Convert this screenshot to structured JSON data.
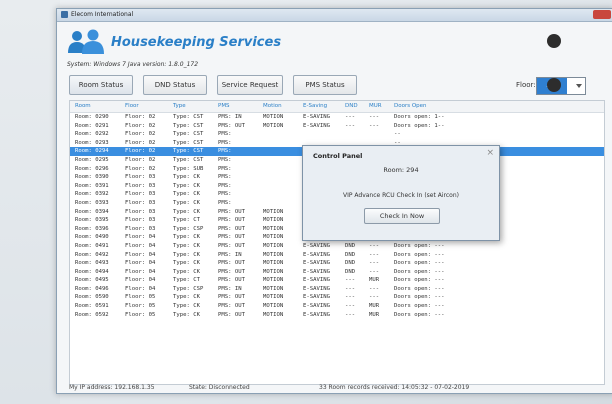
{
  "window": {
    "title": "Elecom International"
  },
  "app": {
    "title": "Housekeeping Services",
    "system_info": "System: Windows 7  Java version: 1.8.0_172"
  },
  "tabs": [
    {
      "label": "Room Status"
    },
    {
      "label": "DND Status"
    },
    {
      "label": "Service Request"
    },
    {
      "label": "PMS Status"
    }
  ],
  "floor": {
    "label": "Floor:",
    "value": "ALL"
  },
  "table": {
    "headers": [
      "Room",
      "Floor",
      "Type",
      "PMS",
      "Motion",
      "E-Saving",
      "DND",
      "MUR",
      "Doors Open"
    ],
    "rows": [
      [
        "Room: 0290",
        "Floor: 02",
        "Type: CST",
        "PMS: IN",
        "MOTION",
        "E-SAVING",
        "---",
        "---",
        "Doors open: 1--"
      ],
      [
        "Room: 0291",
        "Floor: 02",
        "Type: CST",
        "PMS: OUT",
        "MOTION",
        "E-SAVING",
        "---",
        "---",
        "Doors open: 1--"
      ],
      [
        "Room: 0292",
        "Floor: 02",
        "Type: CST",
        "PMS:",
        "",
        "",
        "",
        "",
        "--"
      ],
      [
        "Room: 0293",
        "Floor: 02",
        "Type: CST",
        "PMS:",
        "",
        "",
        "",
        "",
        "--"
      ],
      [
        "Room: 0294",
        "Floor: 02",
        "Type: CST",
        "PMS:",
        "",
        "",
        "",
        "",
        "--"
      ],
      [
        "Room: 0295",
        "Floor: 02",
        "Type: CST",
        "PMS:",
        "",
        "",
        "",
        "",
        "--"
      ],
      [
        "Room: 0296",
        "Floor: 02",
        "Type: SUB",
        "PMS:",
        "",
        "",
        "",
        "",
        "--"
      ],
      [
        "Room: 0390",
        "Floor: 03",
        "Type: CK",
        "PMS:",
        "",
        "",
        "",
        "",
        "--"
      ],
      [
        "Room: 0391",
        "Floor: 03",
        "Type: CK",
        "PMS:",
        "",
        "",
        "",
        "",
        "--"
      ],
      [
        "Room: 0392",
        "Floor: 03",
        "Type: CK",
        "PMS:",
        "",
        "",
        "",
        "",
        "--"
      ],
      [
        "Room: 0393",
        "Floor: 03",
        "Type: CK",
        "PMS:",
        "",
        "",
        "",
        "",
        "--"
      ],
      [
        "Room: 0394",
        "Floor: 03",
        "Type: CK",
        "PMS: OUT",
        "MOTION",
        "E-SAVING",
        "---",
        "---",
        "Doors open: ---"
      ],
      [
        "Room: 0395",
        "Floor: 03",
        "Type: CT",
        "PMS: OUT",
        "MOTION",
        "E-SAVING",
        "---",
        "---",
        "Doors open: ---"
      ],
      [
        "Room: 0396",
        "Floor: 03",
        "Type: CSP",
        "PMS: OUT",
        "MOTION",
        "E-SAVING",
        "---",
        "MUR",
        "Doors open: 1--"
      ],
      [
        "Room: 0490",
        "Floor: 04",
        "Type: CK",
        "PMS: OUT",
        "MOTION",
        "E-SAVING",
        "DND",
        "---",
        "Doors open: 1--"
      ],
      [
        "Room: 0491",
        "Floor: 04",
        "Type: CK",
        "PMS: OUT",
        "MOTION",
        "E-SAVING",
        "DND",
        "---",
        "Doors open: ---"
      ],
      [
        "Room: 0492",
        "Floor: 04",
        "Type: CK",
        "PMS: IN",
        "MOTION",
        "E-SAVING",
        "DND",
        "---",
        "Doors open: ---"
      ],
      [
        "Room: 0493",
        "Floor: 04",
        "Type: CK",
        "PMS: OUT",
        "MOTION",
        "E-SAVING",
        "DND",
        "---",
        "Doors open: ---"
      ],
      [
        "Room: 0494",
        "Floor: 04",
        "Type: CK",
        "PMS: OUT",
        "MOTION",
        "E-SAVING",
        "DND",
        "---",
        "Doors open: ---"
      ],
      [
        "Room: 0495",
        "Floor: 04",
        "Type: CT",
        "PMS: OUT",
        "MOTION",
        "E-SAVING",
        "---",
        "MUR",
        "Doors open: ---"
      ],
      [
        "Room: 0496",
        "Floor: 04",
        "Type: CSP",
        "PMS: IN",
        "MOTION",
        "E-SAVING",
        "---",
        "---",
        "Doors open: ---"
      ],
      [
        "Room: 0590",
        "Floor: 05",
        "Type: CK",
        "PMS: OUT",
        "MOTION",
        "E-SAVING",
        "---",
        "---",
        "Doors open: ---"
      ],
      [
        "Room: 0591",
        "Floor: 05",
        "Type: CK",
        "PMS: OUT",
        "MOTION",
        "E-SAVING",
        "---",
        "MUR",
        "Doors open: ---"
      ],
      [
        "Room: 0592",
        "Floor: 05",
        "Type: CK",
        "PMS: OUT",
        "MOTION",
        "E-SAVING",
        "---",
        "MUR",
        "Doors open: ---"
      ]
    ],
    "selected_row": 4
  },
  "dialog": {
    "title": "Control Panel",
    "room": "Room: 294",
    "message": "VIP Advance RCU Check In (set Aircon)",
    "button": "Check In Now"
  },
  "status": {
    "ip": "My IP address: 192.168.1.35",
    "state": "State: Disconnected",
    "records": "33 Room records received: 14:05:32 - 07-02-2019"
  },
  "colors": {
    "accent": "#2a7fc7",
    "selection": "#3a8ee0"
  },
  "icons": [
    "people-icon",
    "close-icon",
    "dropdown-arrow-icon"
  ]
}
